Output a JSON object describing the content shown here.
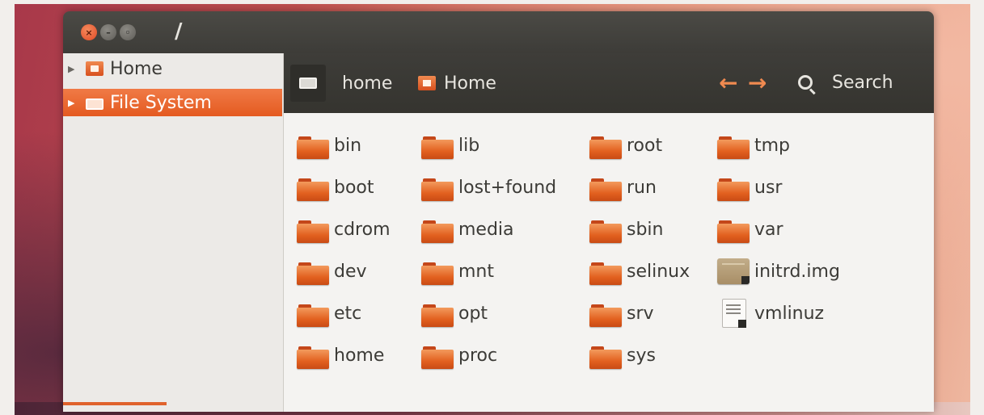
{
  "window": {
    "title": "/",
    "buttons": {
      "close": "×",
      "minimize": "–",
      "maximize": "◦"
    }
  },
  "sidebar": {
    "items": [
      {
        "label": "Home",
        "icon": "home-folder-icon",
        "selected": false
      },
      {
        "label": "File System",
        "icon": "drive-icon",
        "selected": true
      }
    ]
  },
  "toolbar": {
    "breadcrumbs": [
      "home",
      "Home"
    ],
    "back_label": "←",
    "forward_label": "→",
    "search_label": "Search"
  },
  "files": [
    {
      "name": "bin",
      "type": "folder"
    },
    {
      "name": "boot",
      "type": "folder"
    },
    {
      "name": "cdrom",
      "type": "folder"
    },
    {
      "name": "dev",
      "type": "folder"
    },
    {
      "name": "etc",
      "type": "folder"
    },
    {
      "name": "home",
      "type": "folder"
    },
    {
      "name": "lib",
      "type": "folder"
    },
    {
      "name": "lost+found",
      "type": "folder"
    },
    {
      "name": "media",
      "type": "folder"
    },
    {
      "name": "mnt",
      "type": "folder"
    },
    {
      "name": "opt",
      "type": "folder"
    },
    {
      "name": "proc",
      "type": "folder"
    },
    {
      "name": "root",
      "type": "folder"
    },
    {
      "name": "run",
      "type": "folder"
    },
    {
      "name": "sbin",
      "type": "folder"
    },
    {
      "name": "selinux",
      "type": "folder"
    },
    {
      "name": "srv",
      "type": "folder"
    },
    {
      "name": "sys",
      "type": "folder"
    },
    {
      "name": "tmp",
      "type": "folder"
    },
    {
      "name": "usr",
      "type": "folder"
    },
    {
      "name": "var",
      "type": "folder"
    },
    {
      "name": "initrd.img",
      "type": "archive"
    },
    {
      "name": "vmlinuz",
      "type": "text"
    }
  ],
  "colors": {
    "accent": "#e45a20",
    "titlebar": "#3d3c38",
    "content_bg": "#f4f3f1"
  }
}
